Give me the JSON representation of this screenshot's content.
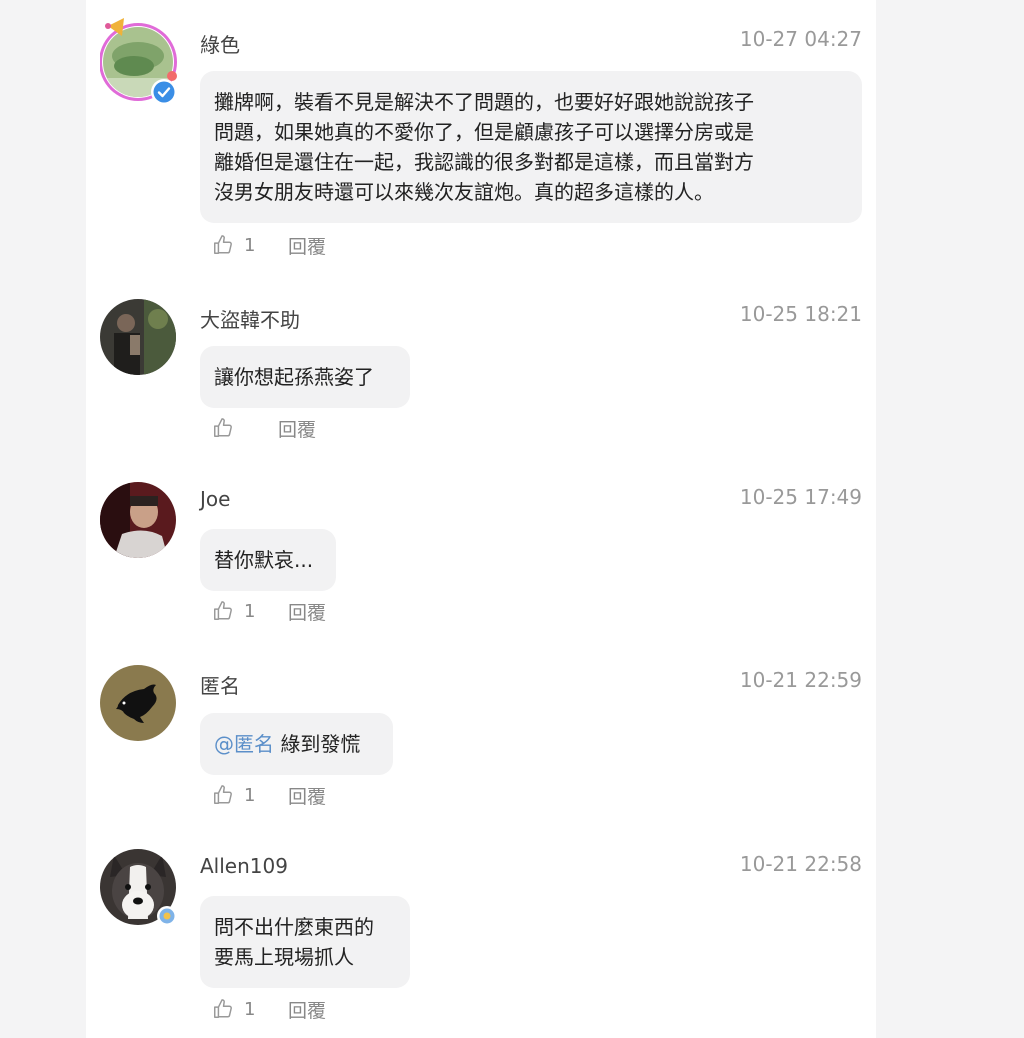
{
  "comments": [
    {
      "author": "綠色",
      "time": "10-27 04:27",
      "lines": [
        "攤牌啊，裝看不見是解決不了問題的，也要好好跟她說說孩子",
        "問題，如果她真的不愛你了，但是顧慮孩子可以選擇分房或是",
        "離婚但是還住在一起，我認識的很多對都是這樣，而且當對方",
        "沒男女朋友時還可以來幾次友誼炮。真的超多這樣的人。"
      ],
      "likes": "1",
      "reply_label": "回覆",
      "verified": true
    },
    {
      "author": "大盜韓不助",
      "time": "10-25 18:21",
      "lines": [
        "讓你想起孫燕姿了"
      ],
      "likes": "",
      "reply_label": "回覆"
    },
    {
      "author": "Joe",
      "time": "10-25 17:49",
      "lines": [
        "替你默哀..."
      ],
      "likes": "1",
      "reply_label": "回覆"
    },
    {
      "author": "匿名",
      "time": "10-21 22:59",
      "mention": "@匿名",
      "lines": [
        "綠到發慌"
      ],
      "likes": "1",
      "reply_label": "回覆"
    },
    {
      "author": "Allen109",
      "time": "10-21 22:58",
      "lines": [
        "問不出什麼東西的",
        "要馬上現場抓人"
      ],
      "likes": "1",
      "reply_label": "回覆"
    }
  ],
  "icons": {
    "like": "thumbs-up-icon",
    "verified": "verified-check-icon"
  },
  "colors": {
    "mention": "#5b8fc9",
    "bubble": "#f2f2f3",
    "verified": "#3a8ee6"
  }
}
